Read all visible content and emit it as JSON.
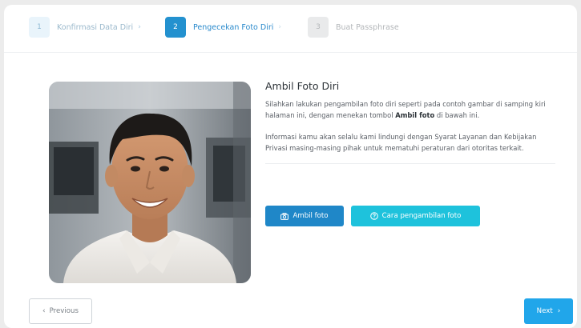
{
  "stepper": {
    "steps": [
      {
        "number": "1",
        "label": "Konfirmasi Data Diri",
        "state": "done"
      },
      {
        "number": "2",
        "label": "Pengecekan Foto Diri",
        "state": "active"
      },
      {
        "number": "3",
        "label": "Buat Passphrase",
        "state": "pending"
      }
    ]
  },
  "main": {
    "title": "Ambil Foto Diri",
    "instruction_before": "Silahkan lakukan pengambilan foto diri seperti pada contoh gambar di samping kiri halaman ini, dengan menekan tombol ",
    "instruction_bold": "Ambil foto",
    "instruction_after": " di bawah ini.",
    "privacy_text": "Informasi kamu akan selalu kami lindungi dengan Syarat Layanan dan Kebijakan Privasi masing-masing pihak untuk mematuhi peraturan dari otoritas terkait.",
    "buttons": {
      "take_photo": {
        "label": "Ambil foto",
        "icon": "camera-icon"
      },
      "how_to": {
        "label": "Cara pengambilan foto",
        "icon": "help-circle-icon"
      }
    }
  },
  "footer": {
    "previous_label": "Previous",
    "next_label": "Next"
  },
  "colors": {
    "primary": "#1f87c8",
    "accent": "#1ec2dc",
    "next": "#21a6ea",
    "active_step": "#2391cf"
  }
}
